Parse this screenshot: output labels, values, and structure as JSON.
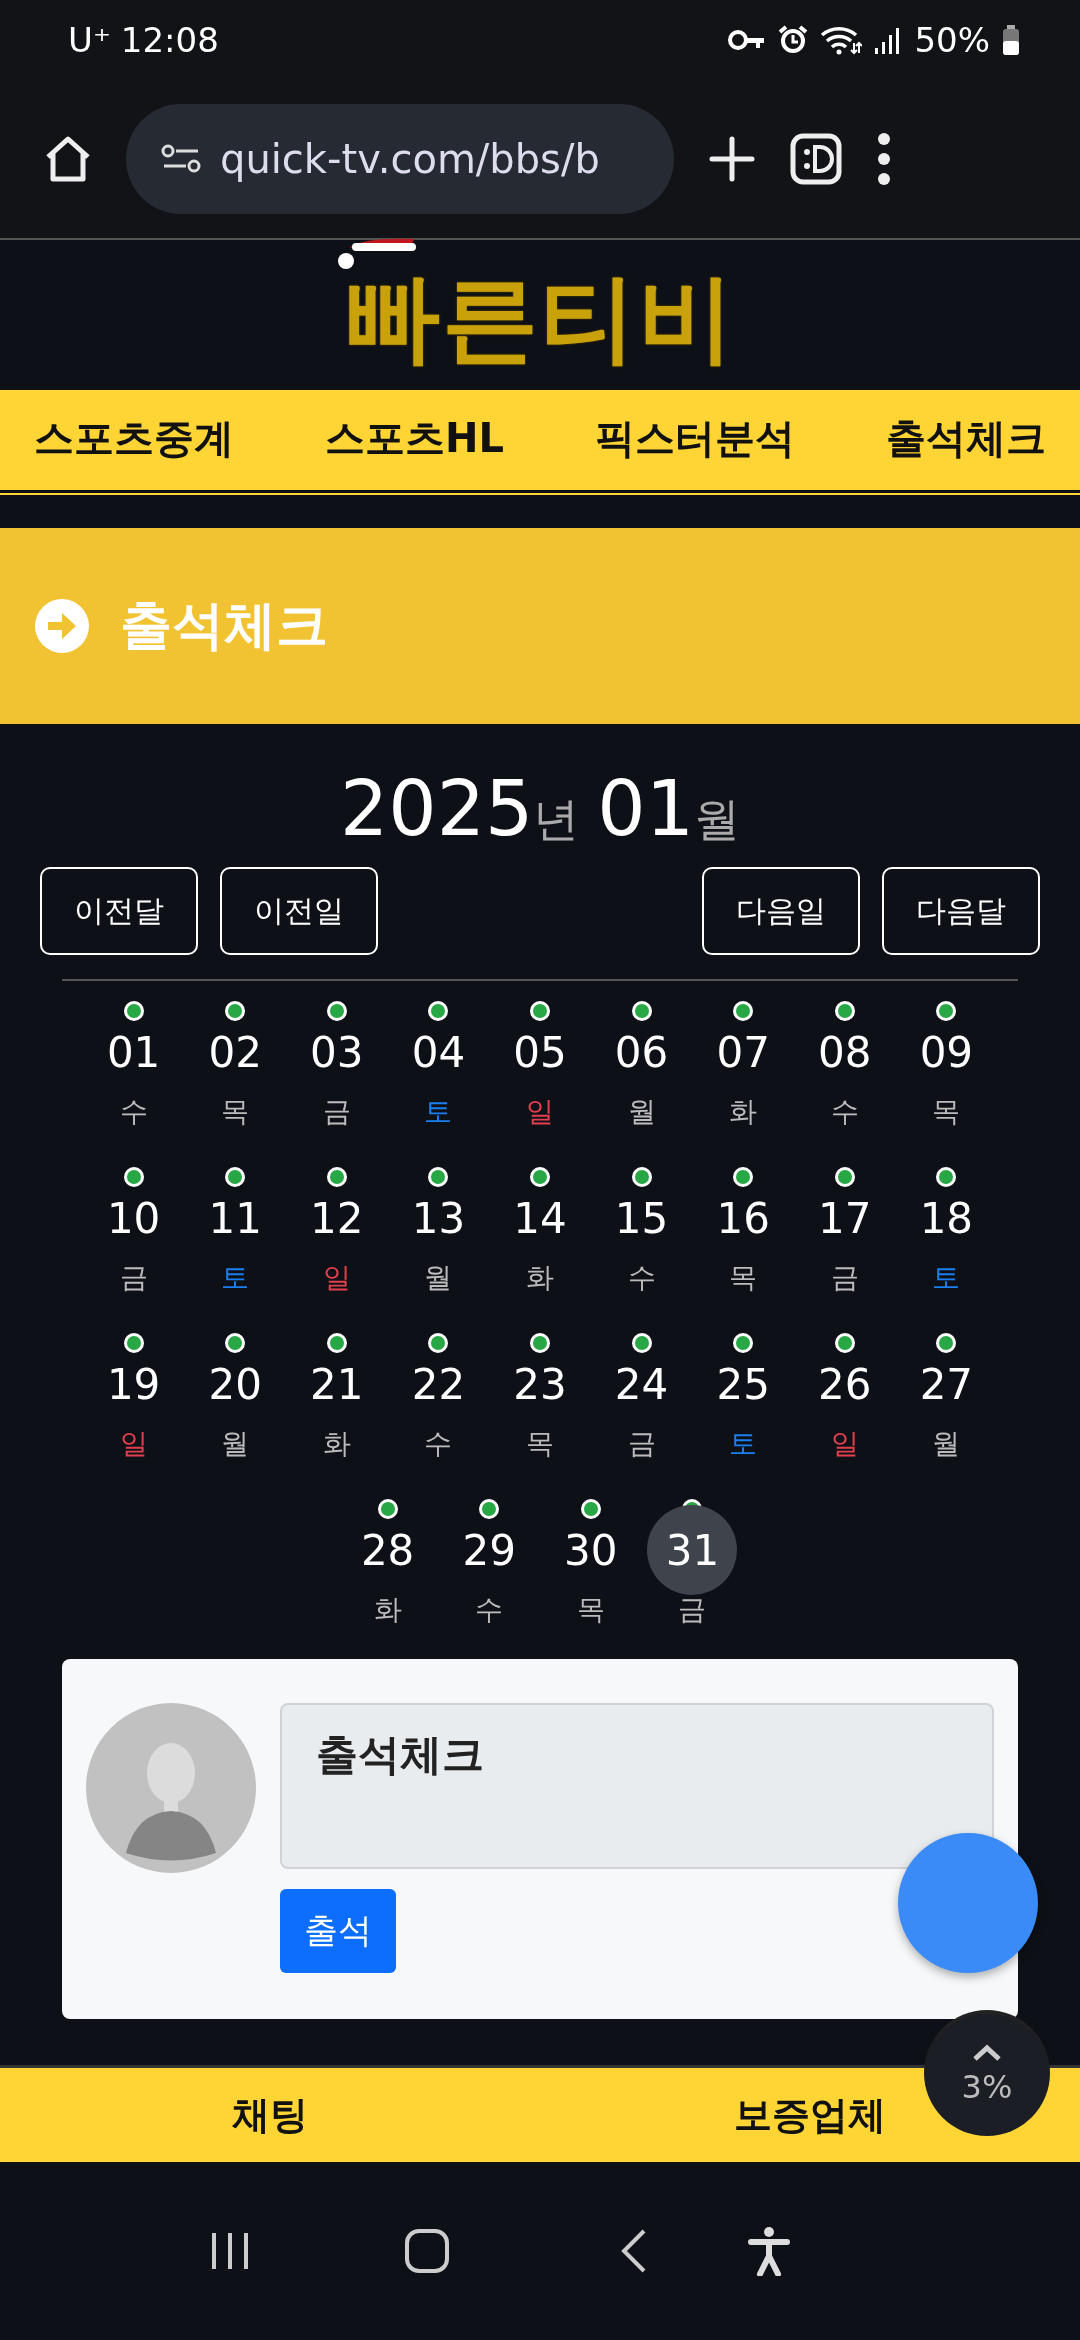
{
  "status_bar": {
    "carrier": "U⁺",
    "time": "12:08",
    "battery": "50%"
  },
  "browser": {
    "url": "quick-tv.com/bbs/b"
  },
  "logo": {
    "text": "빠른티비"
  },
  "nav": [
    {
      "label": "스포츠중계"
    },
    {
      "label": "스포츠HL"
    },
    {
      "label": "픽스터분석"
    },
    {
      "label": "출석체크"
    }
  ],
  "page_title": "출석체크",
  "calendar": {
    "year": "2025",
    "year_unit": "년",
    "month": "01",
    "month_unit": "월",
    "buttons_left": [
      "이전달",
      "이전일"
    ],
    "buttons_right": [
      "다음일",
      "다음달"
    ],
    "days": [
      {
        "day": "01",
        "weekday": "수",
        "color": "#bbbbbb",
        "checked": true,
        "selected": false
      },
      {
        "day": "02",
        "weekday": "목",
        "color": "#bbbbbb",
        "checked": true,
        "selected": false
      },
      {
        "day": "03",
        "weekday": "금",
        "color": "#bbbbbb",
        "checked": true,
        "selected": false
      },
      {
        "day": "04",
        "weekday": "토",
        "color": "#1a7ff0",
        "checked": true,
        "selected": false
      },
      {
        "day": "05",
        "weekday": "일",
        "color": "#e0404e",
        "checked": true,
        "selected": false
      },
      {
        "day": "06",
        "weekday": "월",
        "color": "#bbbbbb",
        "checked": true,
        "selected": false
      },
      {
        "day": "07",
        "weekday": "화",
        "color": "#bbbbbb",
        "checked": true,
        "selected": false
      },
      {
        "day": "08",
        "weekday": "수",
        "color": "#bbbbbb",
        "checked": true,
        "selected": false
      },
      {
        "day": "09",
        "weekday": "목",
        "color": "#bbbbbb",
        "checked": true,
        "selected": false
      },
      {
        "day": "10",
        "weekday": "금",
        "color": "#bbbbbb",
        "checked": true,
        "selected": false
      },
      {
        "day": "11",
        "weekday": "토",
        "color": "#1a7ff0",
        "checked": true,
        "selected": false
      },
      {
        "day": "12",
        "weekday": "일",
        "color": "#e0404e",
        "checked": true,
        "selected": false
      },
      {
        "day": "13",
        "weekday": "월",
        "color": "#bbbbbb",
        "checked": true,
        "selected": false
      },
      {
        "day": "14",
        "weekday": "화",
        "color": "#bbbbbb",
        "checked": true,
        "selected": false
      },
      {
        "day": "15",
        "weekday": "수",
        "color": "#bbbbbb",
        "checked": true,
        "selected": false
      },
      {
        "day": "16",
        "weekday": "목",
        "color": "#bbbbbb",
        "checked": true,
        "selected": false
      },
      {
        "day": "17",
        "weekday": "금",
        "color": "#bbbbbb",
        "checked": true,
        "selected": false
      },
      {
        "day": "18",
        "weekday": "토",
        "color": "#1a7ff0",
        "checked": true,
        "selected": false
      },
      {
        "day": "19",
        "weekday": "일",
        "color": "#e0404e",
        "checked": true,
        "selected": false
      },
      {
        "day": "20",
        "weekday": "월",
        "color": "#bbbbbb",
        "checked": true,
        "selected": false
      },
      {
        "day": "21",
        "weekday": "화",
        "color": "#bbbbbb",
        "checked": true,
        "selected": false
      },
      {
        "day": "22",
        "weekday": "수",
        "color": "#bbbbbb",
        "checked": true,
        "selected": false
      },
      {
        "day": "23",
        "weekday": "목",
        "color": "#bbbbbb",
        "checked": true,
        "selected": false
      },
      {
        "day": "24",
        "weekday": "금",
        "color": "#bbbbbb",
        "checked": true,
        "selected": false
      },
      {
        "day": "25",
        "weekday": "토",
        "color": "#1a7ff0",
        "checked": true,
        "selected": false
      },
      {
        "day": "26",
        "weekday": "일",
        "color": "#e0404e",
        "checked": true,
        "selected": false
      },
      {
        "day": "27",
        "weekday": "월",
        "color": "#bbbbbb",
        "checked": true,
        "selected": false
      },
      {
        "day": "28",
        "weekday": "화",
        "color": "#bbbbbb",
        "checked": true,
        "selected": false
      },
      {
        "day": "29",
        "weekday": "수",
        "color": "#bbbbbb",
        "checked": true,
        "selected": false
      },
      {
        "day": "30",
        "weekday": "목",
        "color": "#bbbbbb",
        "checked": true,
        "selected": false
      },
      {
        "day": "31",
        "weekday": "금",
        "color": "#bbbbbb",
        "checked": true,
        "selected": true
      }
    ]
  },
  "comment_box": {
    "value": "출석체크",
    "submit": "출석"
  },
  "scroll_top": {
    "percent": "3%"
  },
  "bottom_bar": [
    {
      "label": "채팅"
    },
    {
      "label": "보증업체"
    }
  ]
}
